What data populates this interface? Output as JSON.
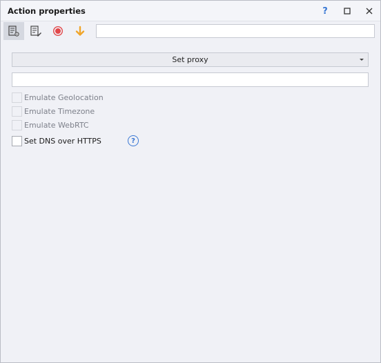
{
  "window": {
    "title": "Action properties",
    "help_glyph": "?",
    "max_icon": "maximize-icon",
    "close_icon": "close-icon"
  },
  "toolbar": {
    "tools": [
      {
        "icon": "properties-settings-icon",
        "active": true
      },
      {
        "icon": "properties-edit-icon",
        "active": false
      },
      {
        "icon": "record-icon",
        "color": "#e2484a"
      },
      {
        "icon": "arrow-down-icon",
        "color": "#f0a52a"
      }
    ],
    "input_value": ""
  },
  "form": {
    "action_select": "Set proxy",
    "proxy_input_value": "",
    "checkboxes": [
      {
        "label": "Emulate Geolocation",
        "enabled": false,
        "checked": false
      },
      {
        "label": "Emulate Timezone",
        "enabled": false,
        "checked": false
      },
      {
        "label": "Emulate WebRTC",
        "enabled": false,
        "checked": false
      },
      {
        "label": "Set DNS over HTTPS",
        "enabled": true,
        "checked": false
      }
    ],
    "help_glyph": "?"
  },
  "colors": {
    "accent": "#3a78d4",
    "record": "#e2484a",
    "arrow": "#f0a52a",
    "background": "#f0f1f6"
  }
}
